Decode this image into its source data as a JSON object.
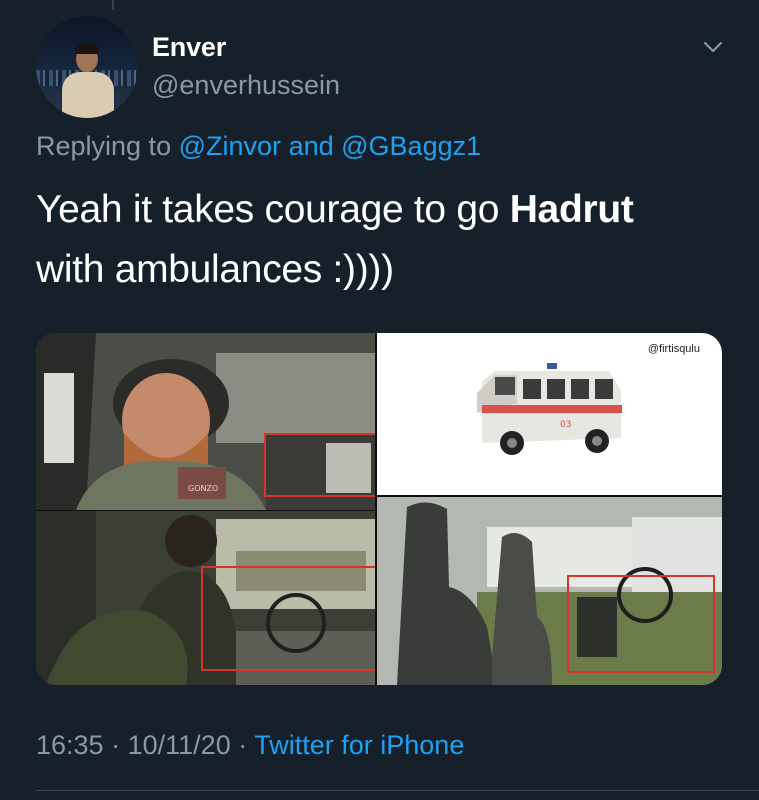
{
  "tweet": {
    "author_name": "Enver",
    "author_handle": "@enverhussein",
    "replying_prefix": "Replying to",
    "reply_to_1": "@Zinvor",
    "reply_and": "and",
    "reply_to_2": "@GBaggz1",
    "text_before": "Yeah it takes courage to go ",
    "text_bold": "Hadrut",
    "text_after": " with ambulances :))))",
    "time": "16:35",
    "date": "10/11/20",
    "source": "Twitter for iPhone",
    "separator": "·"
  },
  "media": {
    "watermark": "@firtisqulu",
    "badge_text": "GONZO",
    "ambulance_number": "03"
  },
  "icons": {
    "menu": "chevron-down-icon"
  },
  "colors": {
    "background": "#15202b",
    "link": "#1da1f2",
    "secondary_text": "#8899a6",
    "highlight_box": "#d3362b"
  }
}
